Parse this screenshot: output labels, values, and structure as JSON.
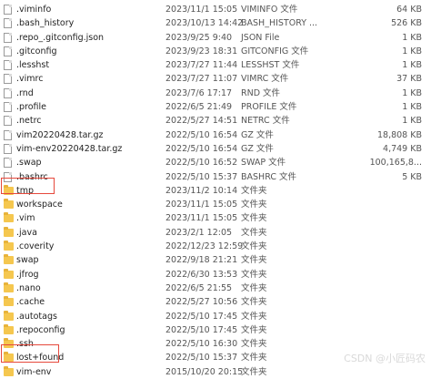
{
  "files": [
    {
      "name": ".viminfo",
      "date": "2023/11/1 15:05",
      "type": "VIMINFO 文件",
      "size": "64 KB",
      "kind": "file"
    },
    {
      "name": ".bash_history",
      "date": "2023/10/13 14:42",
      "type": "BASH_HISTORY ...",
      "size": "526 KB",
      "kind": "file"
    },
    {
      "name": ".repo_.gitconfig.json",
      "date": "2023/9/25 9:40",
      "type": "JSON File",
      "size": "1 KB",
      "kind": "file"
    },
    {
      "name": ".gitconfig",
      "date": "2023/9/23 18:31",
      "type": "GITCONFIG 文件",
      "size": "1 KB",
      "kind": "file"
    },
    {
      "name": ".lesshst",
      "date": "2023/7/27 11:44",
      "type": "LESSHST 文件",
      "size": "1 KB",
      "kind": "file"
    },
    {
      "name": ".vimrc",
      "date": "2023/7/27 11:07",
      "type": "VIMRC 文件",
      "size": "37 KB",
      "kind": "file"
    },
    {
      "name": ".rnd",
      "date": "2023/7/6 17:17",
      "type": "RND 文件",
      "size": "1 KB",
      "kind": "file"
    },
    {
      "name": ".profile",
      "date": "2022/6/5 21:49",
      "type": "PROFILE 文件",
      "size": "1 KB",
      "kind": "file"
    },
    {
      "name": ".netrc",
      "date": "2022/5/27 14:51",
      "type": "NETRC 文件",
      "size": "1 KB",
      "kind": "file"
    },
    {
      "name": "vim20220428.tar.gz",
      "date": "2022/5/10 16:54",
      "type": "GZ 文件",
      "size": "18,808 KB",
      "kind": "file"
    },
    {
      "name": "vim-env20220428.tar.gz",
      "date": "2022/5/10 16:54",
      "type": "GZ 文件",
      "size": "4,749 KB",
      "kind": "file"
    },
    {
      "name": ".swap",
      "date": "2022/5/10 16:52",
      "type": "SWAP 文件",
      "size": "100,165,8...",
      "kind": "file"
    },
    {
      "name": ".bashrc",
      "date": "2022/5/10 15:37",
      "type": "BASHRC 文件",
      "size": "5 KB",
      "kind": "file"
    },
    {
      "name": "tmp",
      "date": "2023/11/2 10:14",
      "type": "文件夹",
      "size": "",
      "kind": "folder"
    },
    {
      "name": "workspace",
      "date": "2023/11/1 15:05",
      "type": "文件夹",
      "size": "",
      "kind": "folder"
    },
    {
      "name": ".vim",
      "date": "2023/11/1 15:05",
      "type": "文件夹",
      "size": "",
      "kind": "folder"
    },
    {
      "name": ".java",
      "date": "2023/2/1 12:05",
      "type": "文件夹",
      "size": "",
      "kind": "folder"
    },
    {
      "name": ".coverity",
      "date": "2022/12/23 12:59",
      "type": "文件夹",
      "size": "",
      "kind": "folder"
    },
    {
      "name": "swap",
      "date": "2022/9/18 21:21",
      "type": "文件夹",
      "size": "",
      "kind": "folder"
    },
    {
      "name": ".jfrog",
      "date": "2022/6/30 13:53",
      "type": "文件夹",
      "size": "",
      "kind": "folder"
    },
    {
      "name": ".nano",
      "date": "2022/6/5 21:55",
      "type": "文件夹",
      "size": "",
      "kind": "folder"
    },
    {
      "name": ".cache",
      "date": "2022/5/27 10:56",
      "type": "文件夹",
      "size": "",
      "kind": "folder"
    },
    {
      "name": ".autotags",
      "date": "2022/5/10 17:45",
      "type": "文件夹",
      "size": "",
      "kind": "folder"
    },
    {
      "name": ".repoconfig",
      "date": "2022/5/10 17:45",
      "type": "文件夹",
      "size": "",
      "kind": "folder"
    },
    {
      "name": ".ssh",
      "date": "2022/5/10 16:30",
      "type": "文件夹",
      "size": "",
      "kind": "folder"
    },
    {
      "name": "lost+found",
      "date": "2022/5/10 15:37",
      "type": "文件夹",
      "size": "",
      "kind": "folder"
    },
    {
      "name": "vim-env",
      "date": "2015/10/20 20:15",
      "type": "文件夹",
      "size": "",
      "kind": "folder"
    }
  ],
  "watermark": "CSDN @小匠码农"
}
